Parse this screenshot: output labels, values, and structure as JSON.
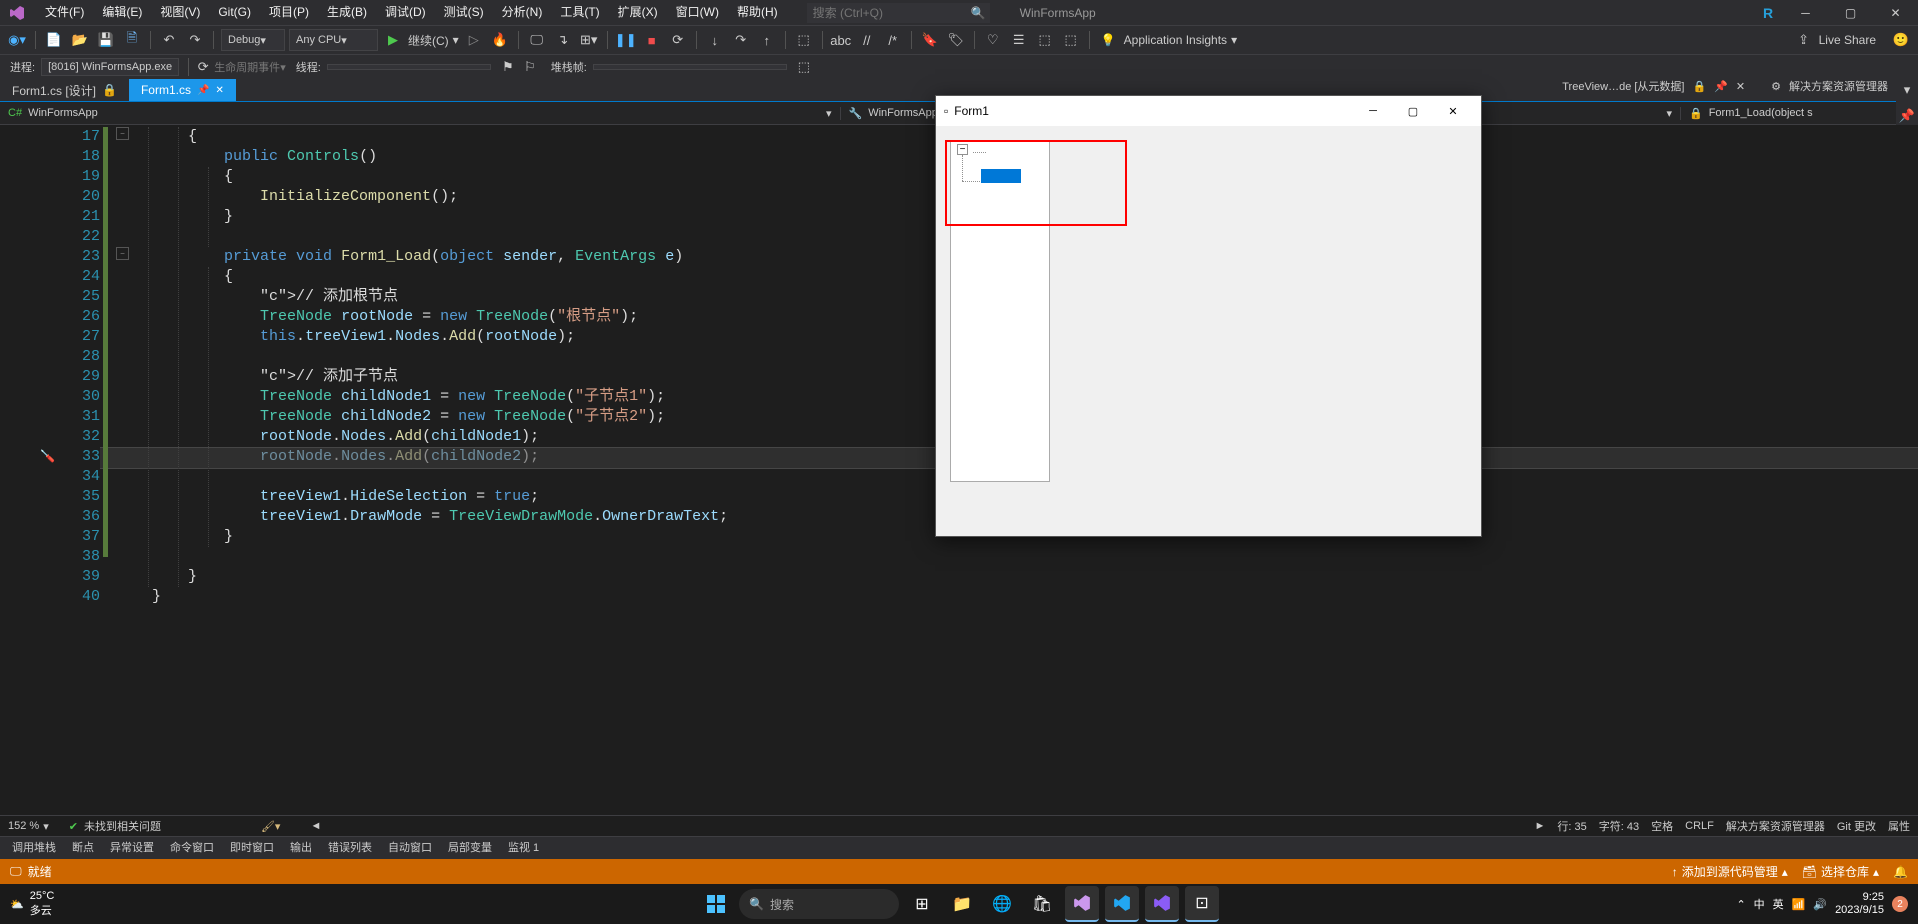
{
  "menubar": {
    "items": [
      "文件(F)",
      "编辑(E)",
      "视图(V)",
      "Git(G)",
      "项目(P)",
      "生成(B)",
      "调试(D)",
      "测试(S)",
      "分析(N)",
      "工具(T)",
      "扩展(X)",
      "窗口(W)",
      "帮助(H)"
    ],
    "search_placeholder": "搜索 (Ctrl+Q)",
    "app_title": "WinFormsApp"
  },
  "toolbar": {
    "config": "Debug",
    "platform": "Any CPU",
    "start_label": "继续(C)",
    "app_insights": "Application Insights",
    "live_share": "Live Share"
  },
  "debugbar": {
    "process_label": "进程:",
    "process_value": "[8016] WinFormsApp.exe",
    "lifecycle": "生命周期事件",
    "thread_label": "线程:",
    "stack_label": "堆栈帧:"
  },
  "tabs": {
    "design": "Form1.cs [设计]",
    "active": "Form1.cs"
  },
  "navbar": {
    "project": "WinFormsApp",
    "scope": "WinFormsApp.Controls",
    "member": "Form1_Load(object s"
  },
  "code": {
    "first_line": 17,
    "lines": [
      "    {",
      "        public Controls()",
      "        {",
      "            InitializeComponent();",
      "        }",
      "",
      "        private void Form1_Load(object sender, EventArgs e)",
      "        {",
      "            // 添加根节点",
      "            TreeNode rootNode = new TreeNode(\"根节点\");",
      "            this.treeView1.Nodes.Add(rootNode);",
      "",
      "            // 添加子节点",
      "            TreeNode childNode1 = new TreeNode(\"子节点1\");",
      "            TreeNode childNode2 = new TreeNode(\"子节点2\");",
      "            rootNode.Nodes.Add(childNode1);",
      "            rootNode.Nodes.Add(childNode2);",
      "",
      "            treeView1.HideSelection = true;",
      "            treeView1.DrawMode = TreeViewDrawMode.OwnerDrawText;",
      "        }",
      "",
      "    }",
      "}"
    ]
  },
  "status": {
    "zoom": "152 %",
    "issues": "未找到相关问题",
    "line": "行: 35",
    "col": "字符: 43",
    "spaces": "空格",
    "eol": "CRLF"
  },
  "right_panel": {
    "context": "TreeView…de [从元数据]",
    "title": "解决方案资源管理器",
    "tabs": [
      "解决方案资源管理器",
      "Git 更改",
      "属性"
    ]
  },
  "output_tabs": [
    "调用堆栈",
    "断点",
    "异常设置",
    "命令窗口",
    "即时窗口",
    "输出",
    "错误列表",
    "自动窗口",
    "局部变量",
    "监视 1"
  ],
  "vs_status": {
    "ready": "就绪",
    "source_control": "添加到源代码管理",
    "repo": "选择仓库"
  },
  "form1": {
    "title": "Form1"
  },
  "taskbar": {
    "temp": "25°C",
    "weather": "多云",
    "search": "搜索",
    "time": "9:25",
    "date": "2023/9/15",
    "ime": "中",
    "badge": "2"
  }
}
